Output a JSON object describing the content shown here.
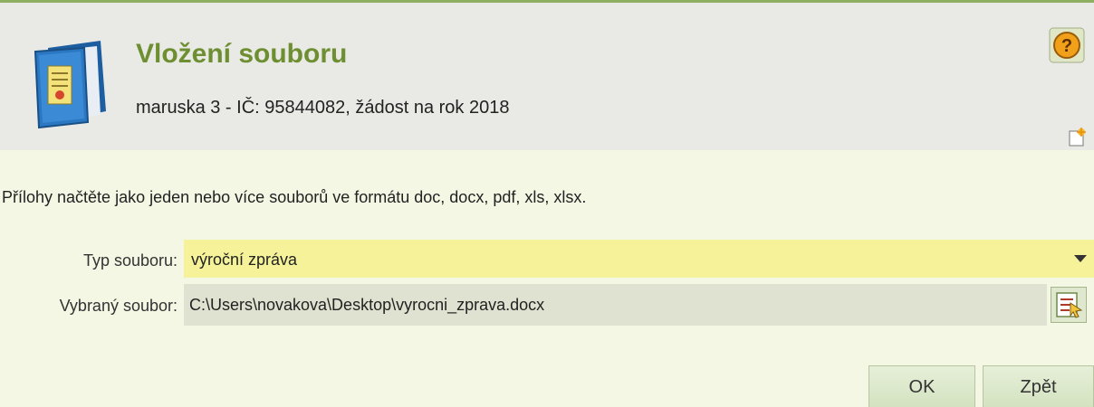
{
  "header": {
    "title": "Vložení souboru",
    "subtitle": "maruska 3 - IČ: 95844082, žádost na rok 2018",
    "icons": [
      "book-icon",
      "help-icon",
      "new-document-icon"
    ]
  },
  "form": {
    "instructions": "Přílohy načtěte jako jeden nebo více souborů ve formátu doc, docx, pdf, xls, xlsx.",
    "type_label": "Typ souboru:",
    "type_value": "výroční zpráva",
    "file_label": "Vybraný soubor:",
    "file_value": "C:\\Users\\novakova\\Desktop\\vyrocni_zprava.docx",
    "browse_icon": "browse-file-icon"
  },
  "buttons": {
    "ok": "OK",
    "back": "Zpět"
  },
  "colors": {
    "title": "#6e8f31",
    "header_bg": "#e9eae5",
    "body_bg": "#f4f7e4",
    "select_bg": "#f6f29a",
    "file_bg": "#dfe2d0"
  }
}
